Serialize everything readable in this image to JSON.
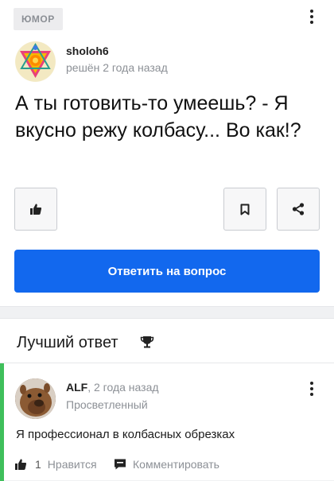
{
  "question": {
    "category": "ЮМОР",
    "author": "sholoh6",
    "meta": "решён 2 года назад",
    "text": "А ты готовить-то умеешь? - Я вкусно режу колбасу... Во как!?",
    "answer_button": "Ответить на вопрос",
    "icons": [
      "thumbs-up-icon",
      "bookmark-icon",
      "share-icon",
      "kebab-menu-icon"
    ]
  },
  "best_answer": {
    "title": "Лучший ответ",
    "author": "ALF",
    "time": ", 2 года назад",
    "rank": "Просветленный",
    "text": "Я профессионал в колбасных обрезках",
    "like_count": "1",
    "like_label": "Нравится",
    "comment_label": "Комментировать",
    "accent_color": "#3fbf5b"
  },
  "colors": {
    "primary": "#1268ee",
    "muted": "#8c9096"
  }
}
